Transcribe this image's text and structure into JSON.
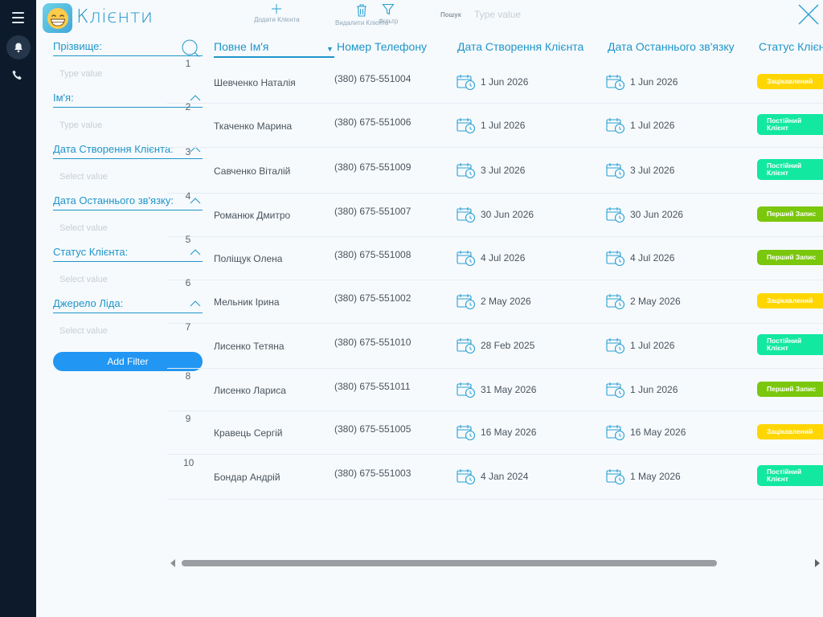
{
  "app": {
    "title": "Клієнти",
    "logo_icon": "grinning-face-icon"
  },
  "toolbar": {
    "add_label": "Додати Клієнта",
    "delete_label": "Видалити Клієнта",
    "filter_label": "Фільтр"
  },
  "search": {
    "label": "Пошук",
    "placeholder": "Type value"
  },
  "filters": {
    "items": [
      {
        "label": "Прізвище:",
        "placeholder": "Type value"
      },
      {
        "label": "Ім'я:",
        "placeholder": "Type value"
      },
      {
        "label": "Дата Створення Клієнта:",
        "placeholder": "Select value"
      },
      {
        "label": "Дата Останнього зв'язку:",
        "placeholder": "Select value"
      },
      {
        "label": "Статус Клієнта:",
        "placeholder": "Select value"
      },
      {
        "label": "Джерело Ліда:",
        "placeholder": "Select value"
      }
    ],
    "add_button": "Add Filter"
  },
  "table": {
    "headers": {
      "full_name": "Повне Ім'я",
      "phone": "Номер Телефону",
      "created": "Дата Створення Клієнта",
      "last_contact": "Дата Останнього зв'язку",
      "status": "Статус Клієн"
    },
    "rows": [
      {
        "num": "1",
        "name": "Шевченко Наталія",
        "phone": "(380) 675-551004",
        "created": "1 Jun 2026",
        "last": "1 Jun 2026",
        "status": "Зацікавлений",
        "status_color": "#ffd600"
      },
      {
        "num": "2",
        "name": "Ткаченко Марина",
        "phone": "(380) 675-551006",
        "created": "1 Jul 2026",
        "last": "1 Jul 2026",
        "status": "Постійний Клієнт",
        "status_color": "#12e8a0"
      },
      {
        "num": "3",
        "name": "Савченко Віталій",
        "phone": "(380) 675-551009",
        "created": "3 Jul 2026",
        "last": "3 Jul 2026",
        "status": "Постійний Клієнт",
        "status_color": "#12e8a0"
      },
      {
        "num": "4",
        "name": "Романюк Дмитро",
        "phone": "(380) 675-551007",
        "created": "30 Jun 2026",
        "last": "30 Jun 2026",
        "status": "Перший Запис",
        "status_color": "#7ac70c"
      },
      {
        "num": "5",
        "name": "Поліщук Олена",
        "phone": "(380) 675-551008",
        "created": "4 Jul 2026",
        "last": "4 Jul 2026",
        "status": "Перший Запис",
        "status_color": "#7ac70c"
      },
      {
        "num": "6",
        "name": "Мельник Ірина",
        "phone": "(380) 675-551002",
        "created": "2 May 2026",
        "last": "2 May 2026",
        "status": "Зацікавлений",
        "status_color": "#ffd600"
      },
      {
        "num": "7",
        "name": "Лисенко Тетяна",
        "phone": "(380) 675-551010",
        "created": "28 Feb 2025",
        "last": "1 Jul 2026",
        "status": "Постійний Клієнт",
        "status_color": "#12e8a0"
      },
      {
        "num": "8",
        "name": "Лисенко Лариса",
        "phone": "(380) 675-551011",
        "created": "31 May 2026",
        "last": "1 Jun 2026",
        "status": "Перший Запис",
        "status_color": "#7ac70c"
      },
      {
        "num": "9",
        "name": "Кравець Сергій",
        "phone": "(380) 675-551005",
        "created": "16 May 2026",
        "last": "16 May 2026",
        "status": "Зацікавлений",
        "status_color": "#ffd600"
      },
      {
        "num": "10",
        "name": "Бондар Андрій",
        "phone": "(380) 675-551003",
        "created": "4 Jan 2024",
        "last": "1 May 2026",
        "status": "Постійний Клієнт",
        "status_color": "#12e8a0"
      }
    ]
  },
  "colors": {
    "accent": "#1f95c8",
    "rail": "#0c1a2b",
    "button": "#2196f3"
  }
}
